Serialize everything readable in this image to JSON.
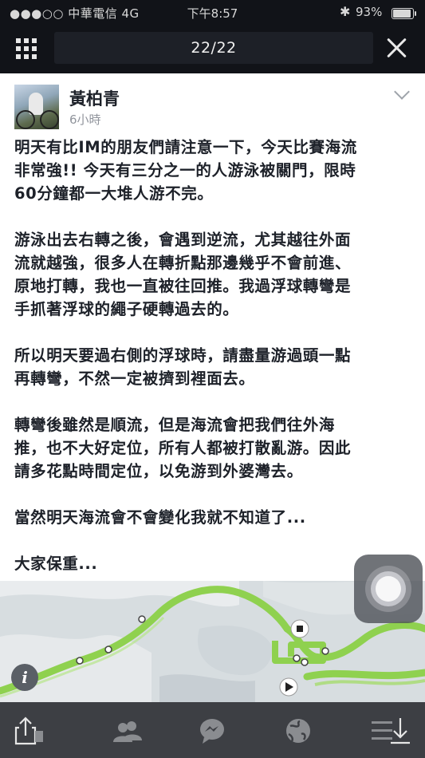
{
  "status_bar": {
    "carrier": "●●●○○ 中華電信 4G",
    "time": "下午8:57",
    "bluetooth": "✱",
    "battery": "93%"
  },
  "viewer": {
    "counter": "22/22"
  },
  "post": {
    "author": "黃柏青",
    "time": "6小時",
    "paragraphs": [
      "明天有比IM的朋友們請注意一下，今天比賽海流\n非常強!! 今天有三分之一的人游泳被關門，限時\n60分鐘都一大堆人游不完。",
      "游泳出去右轉之後，會遇到逆流，尤其越往外面\n流就越強，很多人在轉折點那邊幾乎不會前進、\n原地打轉，我也一直被往回推。我過浮球轉彎是\n手抓著浮球的繩子硬轉過去的。",
      "所以明天要過右側的浮球時，請盡量游過頭一點\n再轉彎，不然一定被擠到裡面去。",
      "轉彎後雖然是順流，但是海流會把我們往外海\n推，也不大好定位，所有人都被打散亂游。因此\n請多花點時間定位，以免游到外婆灣去。",
      "當然明天海流會不會變化我就不知道了...",
      "大家保重..."
    ]
  },
  "map": {
    "info_label": "i"
  },
  "icons": {
    "grid": "grid-icon",
    "close": "close-icon",
    "share": "share-icon",
    "news": "news-feed-icon",
    "friends": "friends-icon",
    "messenger": "messenger-icon",
    "globe": "notifications-globe-icon",
    "menu": "menu-download-icon"
  },
  "colors": {
    "route_green": "#8fd14f",
    "topbar": "#111318",
    "bottombar": "#3d3f44"
  }
}
